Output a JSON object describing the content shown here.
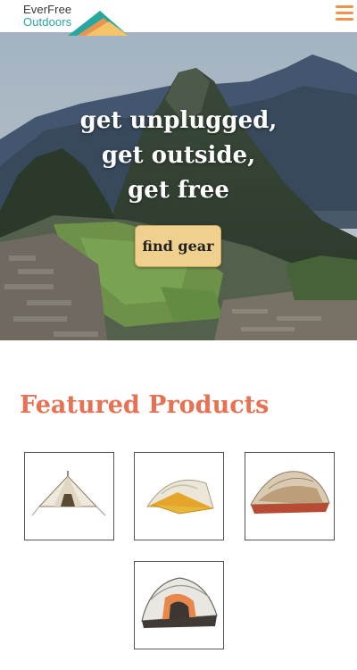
{
  "header": {
    "logo_line1": "EverFree",
    "logo_line2": "Outdoors",
    "menu_icon": "hamburger-menu-icon"
  },
  "hero": {
    "title_lines": [
      "get unplugged,",
      "get outside,",
      "get free"
    ],
    "cta_label": "find gear"
  },
  "featured": {
    "title": "Featured Products",
    "products": [
      {
        "icon": "bell-tent-icon"
      },
      {
        "icon": "yellow-dome-tent-icon"
      },
      {
        "icon": "red-dome-tent-icon"
      },
      {
        "icon": "orange-dome-tent-icon"
      }
    ]
  },
  "colors": {
    "accent_orange": "#e67253",
    "menu_orange": "#f0924a",
    "teal": "#27a7a0",
    "cta_bg": "#f0d08e"
  }
}
